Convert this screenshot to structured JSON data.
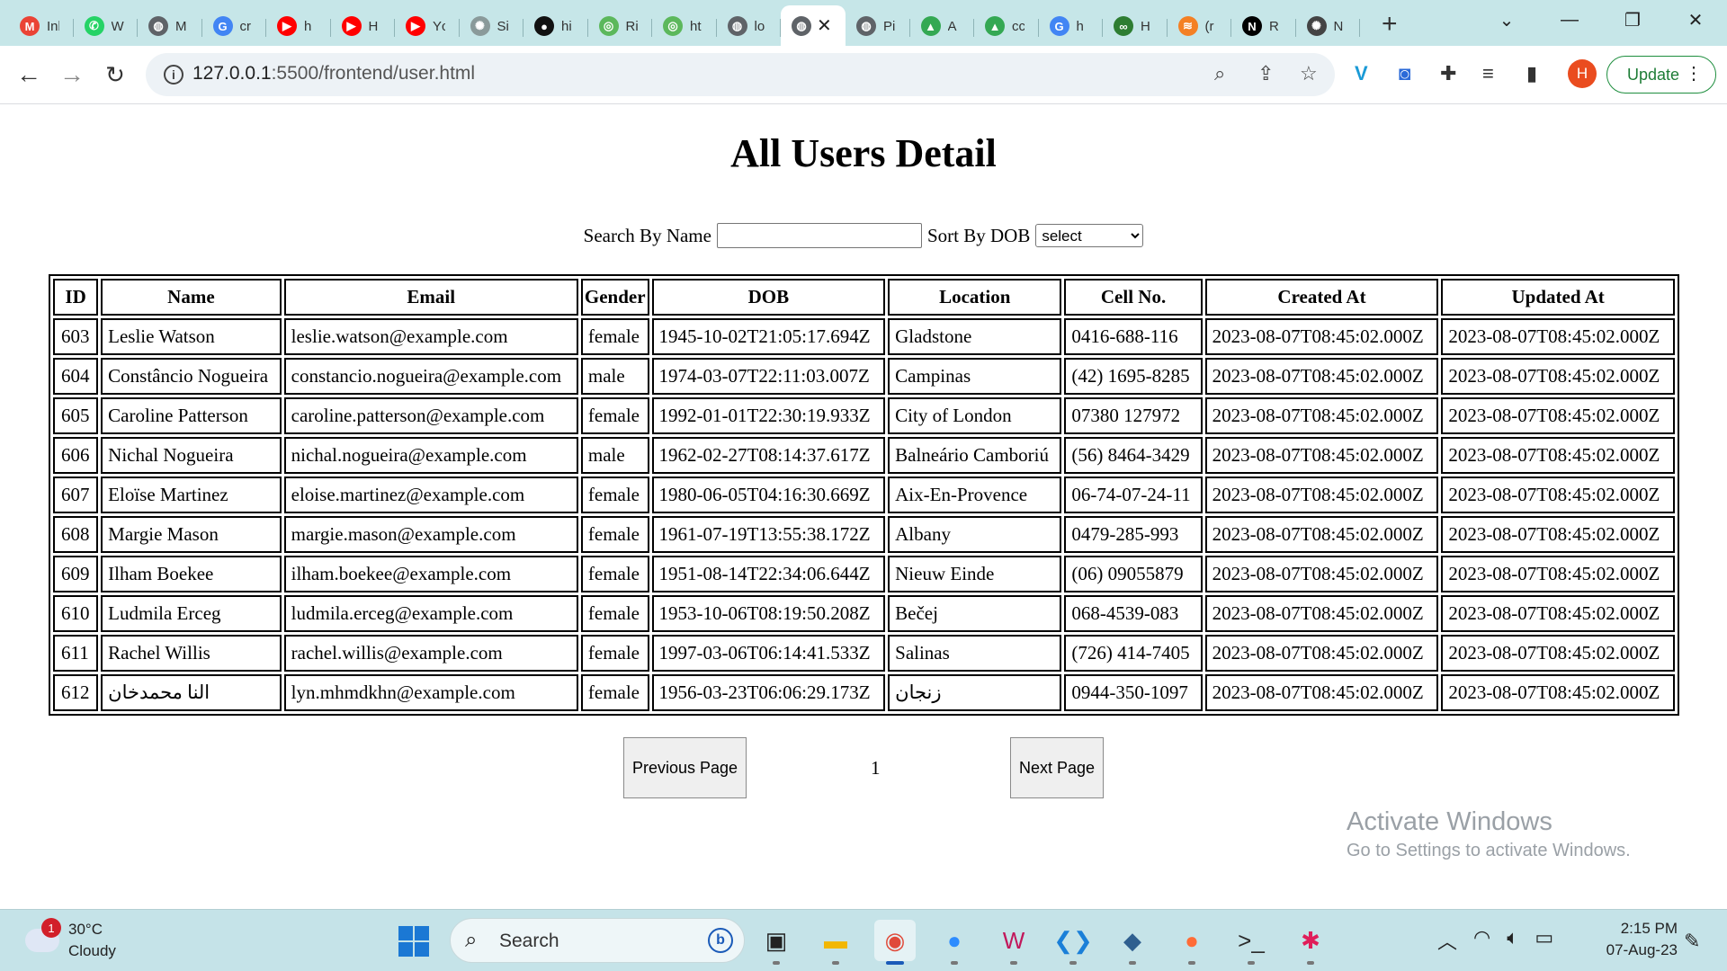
{
  "browser": {
    "tabs": [
      {
        "title": "Inbox",
        "icon": "gmail-icon",
        "color": "#ea4335",
        "glyph": "M"
      },
      {
        "title": "WhatsApp",
        "icon": "whatsapp-icon",
        "color": "#25d366",
        "glyph": "✆"
      },
      {
        "title": "M",
        "icon": "globe-icon",
        "color": "#5f6368",
        "glyph": "◍"
      },
      {
        "title": "cr",
        "icon": "google-icon",
        "color": "#4285f4",
        "glyph": "G"
      },
      {
        "title": "h",
        "icon": "youtube-icon",
        "color": "#ff0000",
        "glyph": "▶"
      },
      {
        "title": "H",
        "icon": "youtube-icon",
        "color": "#ff0000",
        "glyph": "▶"
      },
      {
        "title": "Yc",
        "icon": "youtube-icon",
        "color": "#ff0000",
        "glyph": "▶"
      },
      {
        "title": "Si",
        "icon": "openai-icon",
        "color": "#8a9a9a",
        "glyph": "✺"
      },
      {
        "title": "hi",
        "icon": "github-icon",
        "color": "#111111",
        "glyph": "●"
      },
      {
        "title": "Ri",
        "icon": "extension-icon",
        "color": "#5cb85c",
        "glyph": "◎"
      },
      {
        "title": "ht",
        "icon": "extension-icon",
        "color": "#5cb85c",
        "glyph": "◎"
      },
      {
        "title": "lo",
        "icon": "globe-icon",
        "color": "#5f6368",
        "glyph": "◍"
      },
      {
        "title": "",
        "icon": "globe-icon",
        "color": "#5f6368",
        "glyph": "◍",
        "active": true
      },
      {
        "title": "Pi",
        "icon": "globe-icon",
        "color": "#5f6368",
        "glyph": "◍"
      },
      {
        "title": "A",
        "icon": "drive-icon",
        "color": "#34a853",
        "glyph": "▲"
      },
      {
        "title": "cc",
        "icon": "drive-icon",
        "color": "#34a853",
        "glyph": "▲"
      },
      {
        "title": "h",
        "icon": "google-icon",
        "color": "#4285f4",
        "glyph": "G"
      },
      {
        "title": "H",
        "icon": "infinity-icon",
        "color": "#2e7d32",
        "glyph": "∞"
      },
      {
        "title": "(r",
        "icon": "stack-icon",
        "color": "#f48024",
        "glyph": "≋"
      },
      {
        "title": "R",
        "icon": "notion-icon",
        "color": "#000000",
        "glyph": "N"
      },
      {
        "title": "N",
        "icon": "openai-icon",
        "color": "#444444",
        "glyph": "✺"
      }
    ],
    "url_host": "127.0.0.1",
    "url_rest": ":5500/frontend/user.html",
    "profile_initial": "H",
    "update_label": "Update"
  },
  "page": {
    "title": "All Users Detail",
    "search_label": "Search By Name",
    "search_value": "",
    "sort_label": "Sort By DOB",
    "sort_selected": "select",
    "table": {
      "headers": [
        "ID",
        "Name",
        "Email",
        "Gender",
        "DOB",
        "Location",
        "Cell No.",
        "Created At",
        "Updated At"
      ],
      "rows": [
        [
          "603",
          "Leslie Watson",
          "leslie.watson@example.com",
          "female",
          "1945-10-02T21:05:17.694Z",
          "Gladstone",
          "0416-688-116",
          "2023-08-07T08:45:02.000Z",
          "2023-08-07T08:45:02.000Z"
        ],
        [
          "604",
          "Constâncio Nogueira",
          "constancio.nogueira@example.com",
          "male",
          "1974-03-07T22:11:03.007Z",
          "Campinas",
          "(42) 1695-8285",
          "2023-08-07T08:45:02.000Z",
          "2023-08-07T08:45:02.000Z"
        ],
        [
          "605",
          "Caroline Patterson",
          "caroline.patterson@example.com",
          "female",
          "1992-01-01T22:30:19.933Z",
          "City of London",
          "07380 127972",
          "2023-08-07T08:45:02.000Z",
          "2023-08-07T08:45:02.000Z"
        ],
        [
          "606",
          "Nichal Nogueira",
          "nichal.nogueira@example.com",
          "male",
          "1962-02-27T08:14:37.617Z",
          "Balneário Camboriú",
          "(56) 8464-3429",
          "2023-08-07T08:45:02.000Z",
          "2023-08-07T08:45:02.000Z"
        ],
        [
          "607",
          "Eloïse Martinez",
          "eloise.martinez@example.com",
          "female",
          "1980-06-05T04:16:30.669Z",
          "Aix-En-Provence",
          "06-74-07-24-11",
          "2023-08-07T08:45:02.000Z",
          "2023-08-07T08:45:02.000Z"
        ],
        [
          "608",
          "Margie Mason",
          "margie.mason@example.com",
          "female",
          "1961-07-19T13:55:38.172Z",
          "Albany",
          "0479-285-993",
          "2023-08-07T08:45:02.000Z",
          "2023-08-07T08:45:02.000Z"
        ],
        [
          "609",
          "Ilham Boekee",
          "ilham.boekee@example.com",
          "female",
          "1951-08-14T22:34:06.644Z",
          "Nieuw Einde",
          "(06) 09055879",
          "2023-08-07T08:45:02.000Z",
          "2023-08-07T08:45:02.000Z"
        ],
        [
          "610",
          "Ludmila Erceg",
          "ludmila.erceg@example.com",
          "female",
          "1953-10-06T08:19:50.208Z",
          "Bečej",
          "068-4539-083",
          "2023-08-07T08:45:02.000Z",
          "2023-08-07T08:45:02.000Z"
        ],
        [
          "611",
          "Rachel Willis",
          "rachel.willis@example.com",
          "female",
          "1997-03-06T06:14:41.533Z",
          "Salinas",
          "(726) 414-7405",
          "2023-08-07T08:45:02.000Z",
          "2023-08-07T08:45:02.000Z"
        ],
        [
          "612",
          "النا محمدخان",
          "lyn.mhmdkhn@example.com",
          "female",
          "1956-03-23T06:06:29.173Z",
          "زنجان",
          "0944-350-1097",
          "2023-08-07T08:45:02.000Z",
          "2023-08-07T08:45:02.000Z"
        ]
      ]
    },
    "pager": {
      "prev_label": "Previous Page",
      "page_number": "1",
      "next_label": "Next Page"
    },
    "watermark": {
      "line1": "Activate Windows",
      "line2": "Go to Settings to activate Windows."
    }
  },
  "taskbar": {
    "weather_temp": "30°C",
    "weather_desc": "Cloudy",
    "weather_badge": "1",
    "search_label": "Search",
    "apps": [
      {
        "name": "task-view-icon",
        "glyph": "▣",
        "color": "#222222"
      },
      {
        "name": "file-explorer-icon",
        "glyph": "▬",
        "color": "#f2b705"
      },
      {
        "name": "chrome-icon",
        "glyph": "◉",
        "color": "#e04a3a",
        "active": true
      },
      {
        "name": "zoom-icon",
        "glyph": "●",
        "color": "#2d8cff"
      },
      {
        "name": "wps-icon",
        "glyph": "W",
        "color": "#c2185b"
      },
      {
        "name": "vscode-icon",
        "glyph": "❮❯",
        "color": "#1a7fd8"
      },
      {
        "name": "mysql-workbench-icon",
        "glyph": "◆",
        "color": "#2f5f8f"
      },
      {
        "name": "postman-icon",
        "glyph": "●",
        "color": "#ff6c37"
      },
      {
        "name": "terminal-icon",
        "glyph": ">_",
        "color": "#2b2b2b"
      },
      {
        "name": "slack-icon",
        "glyph": "✱",
        "color": "#e01e5a"
      }
    ],
    "time": "2:15 PM",
    "date": "07-Aug-23"
  }
}
